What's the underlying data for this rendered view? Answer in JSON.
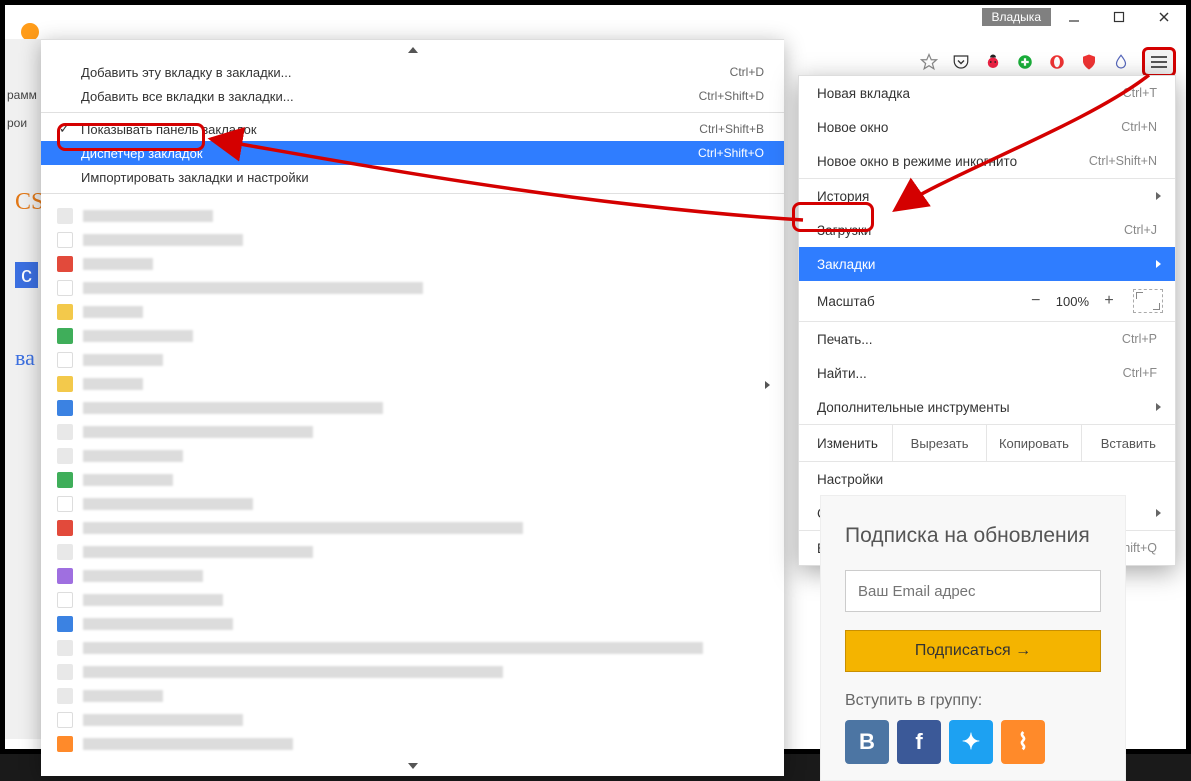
{
  "window": {
    "user_tag": "Владыка",
    "minimize": "–",
    "maximize": "◻",
    "close": "✕"
  },
  "toolbar_icons": [
    "star",
    "pocket",
    "ladybug",
    "ublock",
    "opera",
    "adblock",
    "drop",
    "hamburger"
  ],
  "left_fragments": {
    "tab1": "рамм",
    "tab2": "рои",
    "cs": "CS",
    "c": "с",
    "ba": "ва"
  },
  "bookmarks_submenu": {
    "add_tab": {
      "label": "Добавить эту вкладку в закладки...",
      "shortcut": "Ctrl+D"
    },
    "add_all": {
      "label": "Добавить все вкладки в закладки...",
      "shortcut": "Ctrl+Shift+D"
    },
    "show_bar": {
      "label": "Показывать панель закладок",
      "shortcut": "Ctrl+Shift+B"
    },
    "manager": {
      "label": "Диспетчер закладок",
      "shortcut": "Ctrl+Shift+O"
    },
    "import": {
      "label": "Импортировать закладки и настройки"
    }
  },
  "main_menu": {
    "new_tab": {
      "label": "Новая вкладка",
      "shortcut": "Ctrl+T"
    },
    "new_window": {
      "label": "Новое окно",
      "shortcut": "Ctrl+N"
    },
    "incognito": {
      "label": "Новое окно в режиме инкогнито",
      "shortcut": "Ctrl+Shift+N"
    },
    "history": {
      "label": "История"
    },
    "downloads": {
      "label": "Загрузки",
      "shortcut": "Ctrl+J"
    },
    "bookmarks": {
      "label": "Закладки"
    },
    "zoom": {
      "label": "Масштаб",
      "value": "100%",
      "minus": "−",
      "plus": "+"
    },
    "print": {
      "label": "Печать...",
      "shortcut": "Ctrl+P"
    },
    "find": {
      "label": "Найти...",
      "shortcut": "Ctrl+F"
    },
    "more_tools": {
      "label": "Дополнительные инструменты"
    },
    "edit": {
      "label": "Изменить",
      "cut": "Вырезать",
      "copy": "Копировать",
      "paste": "Вставить"
    },
    "settings": {
      "label": "Настройки"
    },
    "help": {
      "label": "Справка"
    },
    "exit": {
      "label": "Выход",
      "shortcut": "Ctrl+Shift+Q"
    }
  },
  "sidebar": {
    "title": "Подписка на обновления",
    "email_placeholder": "Ваш Email адрес",
    "subscribe": "Подписаться →",
    "group_label": "Вступить в группу:"
  }
}
